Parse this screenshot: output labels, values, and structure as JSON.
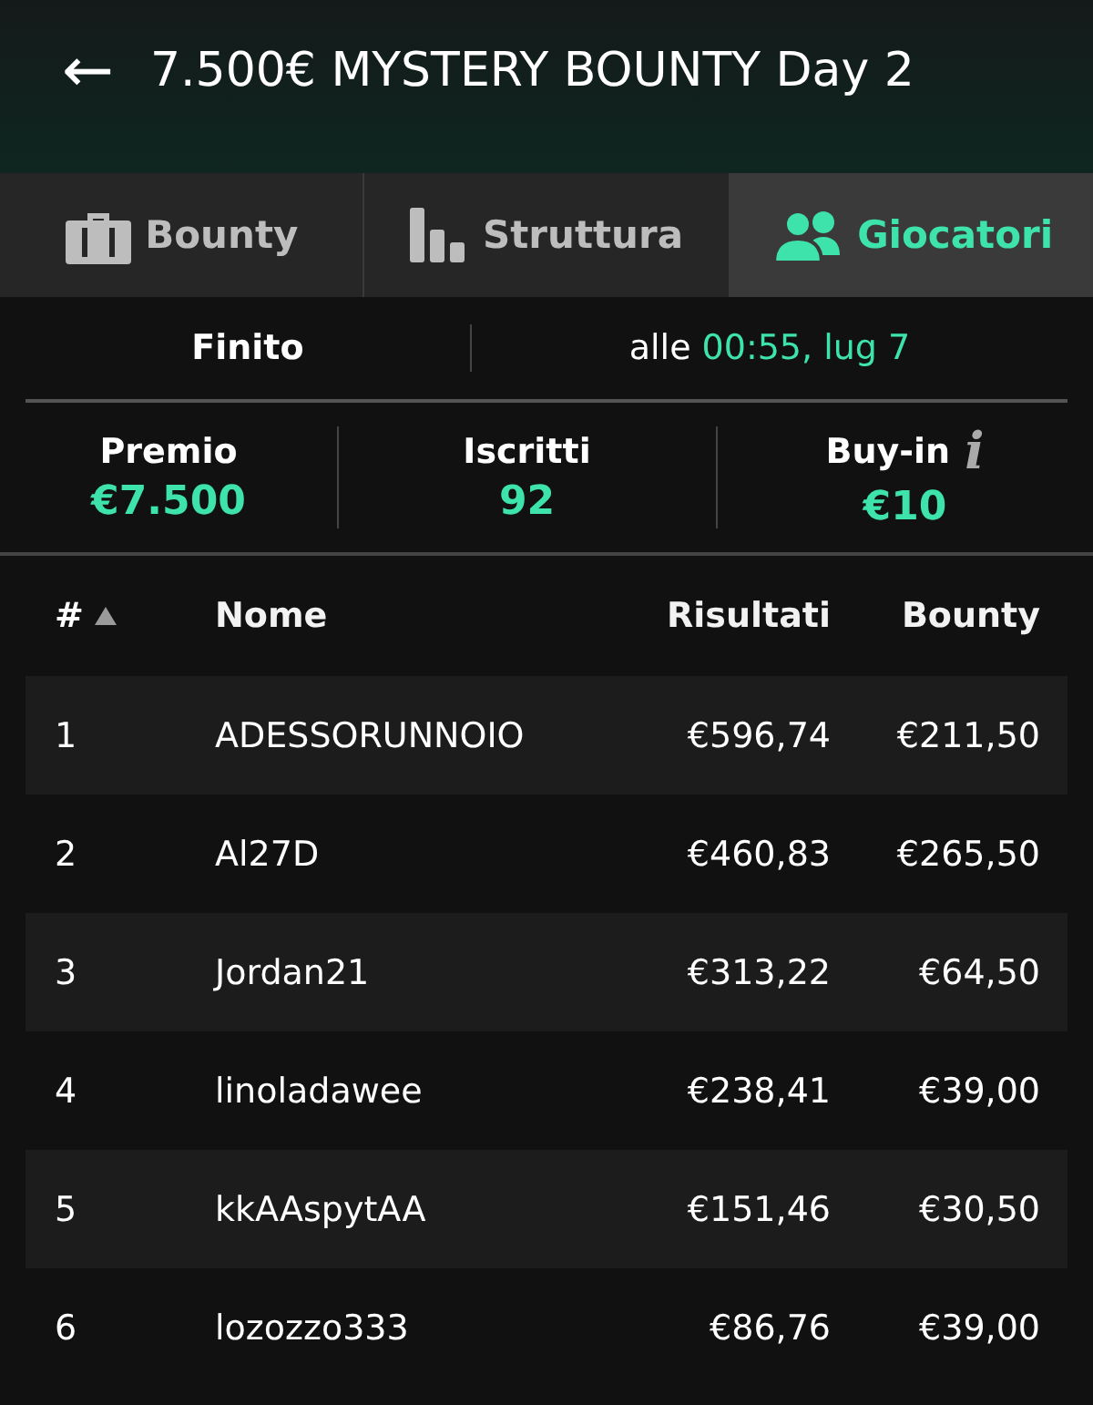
{
  "header": {
    "back": "←",
    "title": "7.500€ MYSTERY BOUNTY Day 2"
  },
  "tabs": [
    {
      "label": "Bounty",
      "selected": false
    },
    {
      "label": "Struttura",
      "selected": false
    },
    {
      "label": "Giocatori",
      "selected": true
    }
  ],
  "status": {
    "state": "Finito",
    "prefix": "alle",
    "time": "00:55, lug 7"
  },
  "stats": [
    {
      "label": "Premio",
      "value": "€7.500"
    },
    {
      "label": "Iscritti",
      "value": "92"
    },
    {
      "label": "Buy-in",
      "value": "€10",
      "info": "i"
    }
  ],
  "table": {
    "columns": [
      {
        "label": "#",
        "sorted": true
      },
      {
        "label": "Nome",
        "sorted": false
      },
      {
        "label": "Risultati",
        "sorted": false
      },
      {
        "label": "Bounty",
        "sorted": false
      }
    ],
    "rows": [
      [
        "1",
        "ADESSORUNNOIO",
        "€596,74",
        "€211,50"
      ],
      [
        "2",
        "Al27D",
        "€460,83",
        "€265,50"
      ],
      [
        "3",
        "Jordan21",
        "€313,22",
        "€64,50"
      ],
      [
        "4",
        "linoladawee",
        "€238,41",
        "€39,00"
      ],
      [
        "5",
        "kkAAspytAA",
        "€151,46",
        "€30,50"
      ],
      [
        "6",
        "lozozzo333",
        "€86,76",
        "€39,00"
      ]
    ]
  }
}
